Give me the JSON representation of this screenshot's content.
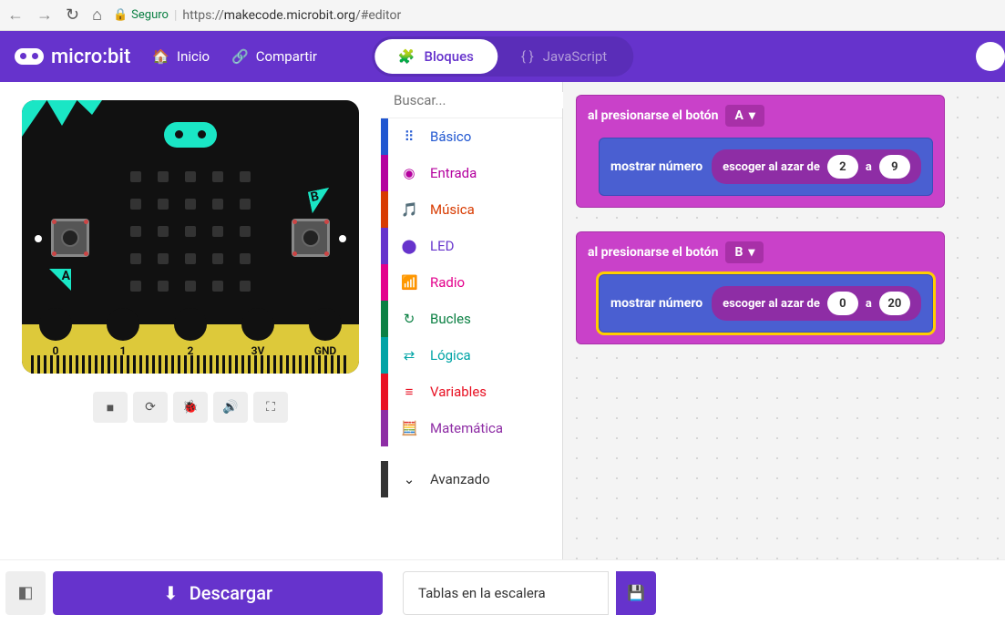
{
  "browser": {
    "secure": "Seguro",
    "url_prefix": "https://",
    "url_host": "makecode.microbit.org",
    "url_path": "/#editor"
  },
  "header": {
    "logo": "micro:bit",
    "home": "Inicio",
    "share": "Compartir",
    "blocks": "Bloques",
    "javascript": "JavaScript"
  },
  "microbit": {
    "btn_a": "A",
    "btn_b": "B",
    "pins": [
      "0",
      "1",
      "2",
      "3V",
      "GND"
    ]
  },
  "search": {
    "placeholder": "Buscar..."
  },
  "categories": {
    "basico": "Básico",
    "entrada": "Entrada",
    "musica": "Música",
    "led": "LED",
    "radio": "Radio",
    "bucles": "Bucles",
    "logica": "Lógica",
    "variables": "Variables",
    "mate": "Matemática",
    "avanzado": "Avanzado"
  },
  "blocks": {
    "b1": {
      "event": "al presionarse el botón",
      "button": "A",
      "show": "mostrar número",
      "rand": "escoger al azar de",
      "from": "2",
      "sep": "a",
      "to": "9"
    },
    "b2": {
      "event": "al presionarse el botón",
      "button": "B",
      "show": "mostrar número",
      "rand": "escoger al azar de",
      "from": "0",
      "sep": "a",
      "to": "20"
    }
  },
  "footer": {
    "download": "Descargar",
    "project_name": "Tablas en la escalera"
  }
}
